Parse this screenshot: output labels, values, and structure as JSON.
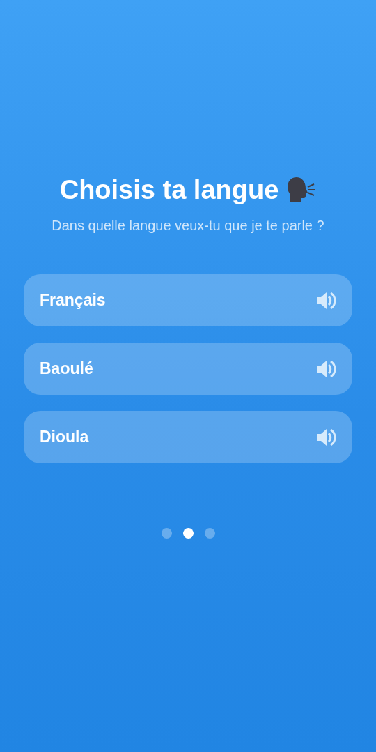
{
  "title": "Choisis ta langue",
  "subtitle": "Dans quelle langue veux-tu que je te parle ?",
  "languages": [
    {
      "label": "Français"
    },
    {
      "label": "Baoulé"
    },
    {
      "label": "Dioula"
    }
  ],
  "pager": [
    {
      "selected": false
    },
    {
      "selected": true
    },
    {
      "selected": false
    }
  ]
}
